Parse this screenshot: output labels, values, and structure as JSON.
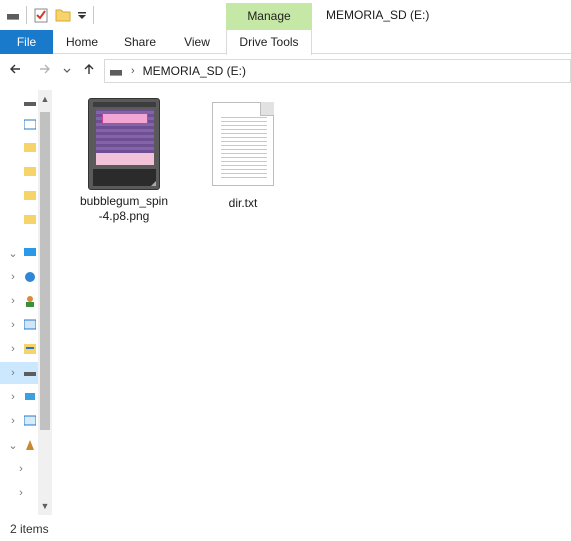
{
  "window": {
    "title": "MEMORIA_SD (E:)"
  },
  "ribbon": {
    "contextual_group": "Manage",
    "tabs": [
      {
        "label": "File"
      },
      {
        "label": "Home"
      },
      {
        "label": "Share"
      },
      {
        "label": "View"
      },
      {
        "label": "Drive Tools"
      }
    ]
  },
  "address": {
    "path": "MEMORIA_SD (E:)"
  },
  "files": [
    {
      "name": "bubblegum_spin-4.p8.png",
      "name_line1": "bubblegum_spin",
      "name_line2": "-4.p8.png",
      "icon": "pico8-cart-icon"
    },
    {
      "name": "dir.txt",
      "icon": "text-document-icon"
    }
  ],
  "status": {
    "item_count": "2 items"
  },
  "colors": {
    "file_tab": "#1979ca",
    "manage_tab": "#c5e8a6",
    "selection": "#cce8ff"
  }
}
